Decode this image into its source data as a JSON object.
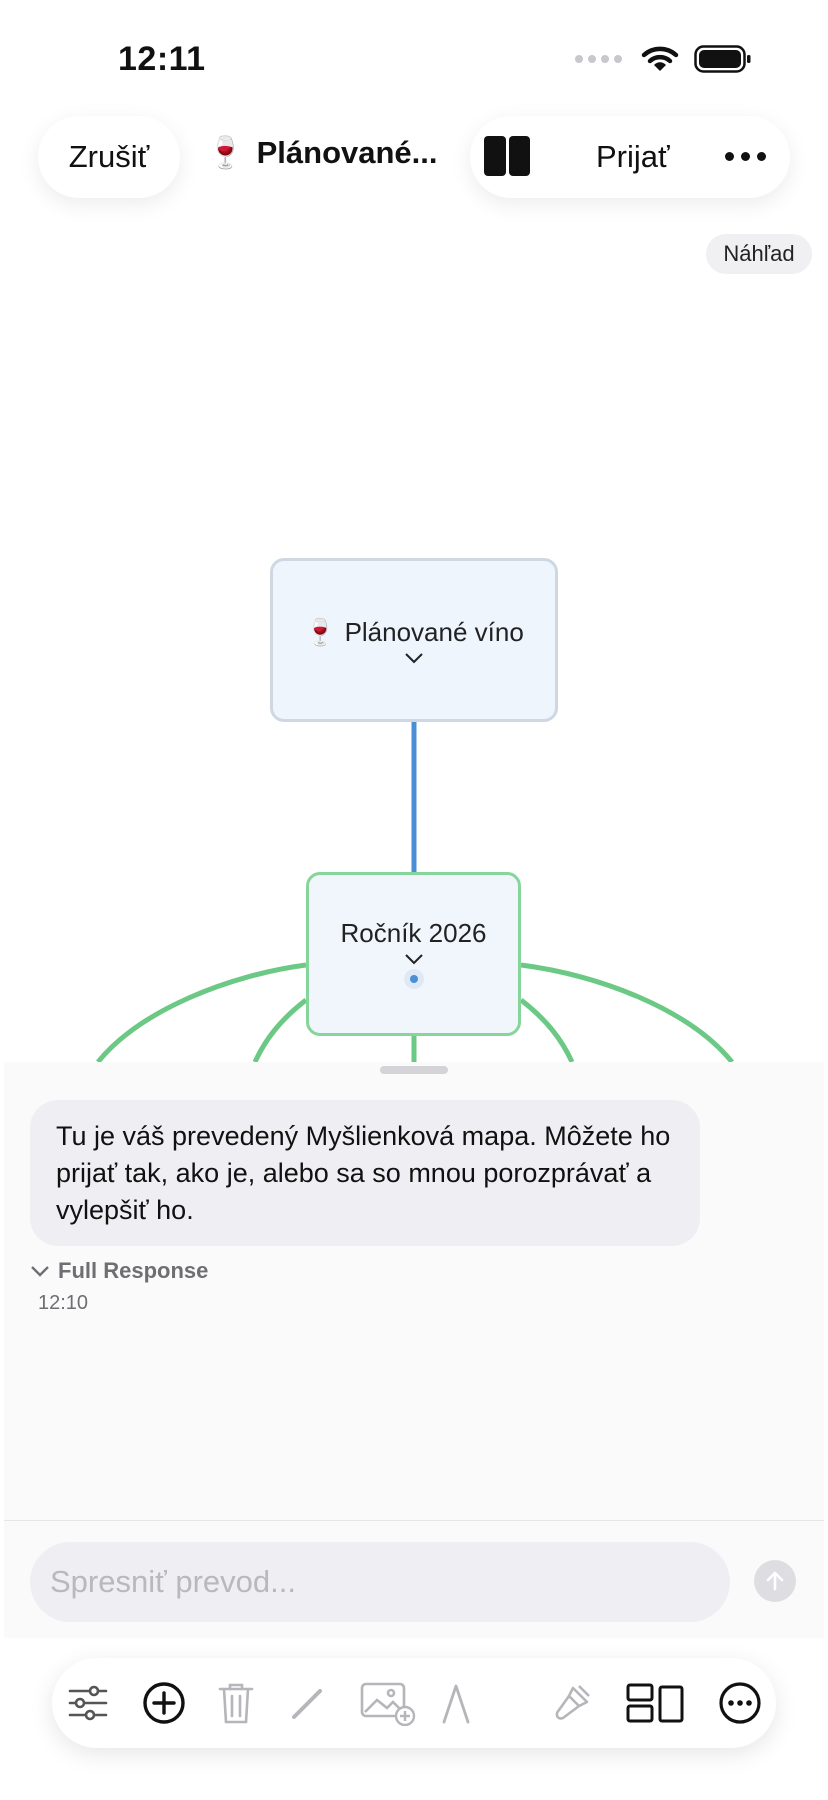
{
  "status_bar": {
    "time": "12:11"
  },
  "header": {
    "cancel_label": "Zrušiť",
    "title_emoji": "🍷",
    "title": "Plánované...",
    "accept_label": "Prijať"
  },
  "preview_badge": "Náhľad",
  "mindmap": {
    "root": {
      "emoji": "🍷",
      "label": "Plánované víno"
    },
    "child": {
      "label": "Ročník 2026"
    }
  },
  "chat": {
    "message": "Tu je váš prevedený Myšlienková mapa. Môžete ho prijať tak, ako je, alebo sa so mnou porozprávať a vylepšiť ho.",
    "full_response_label": "Full Response",
    "timestamp": "12:10",
    "input_placeholder": "Spresniť prevod...",
    "input_value": ""
  },
  "toolbar": {
    "icons": [
      "sliders-icon",
      "add-circle-icon",
      "trash-icon",
      "pencil-icon",
      "add-image-icon",
      "text-style-icon",
      "paint-brush-icon",
      "layout-icon",
      "more-circle-icon"
    ]
  },
  "colors": {
    "accent_blue": "#4a8fd4",
    "branch_green": "#6cc985",
    "node_fill": "#eef5fd"
  }
}
